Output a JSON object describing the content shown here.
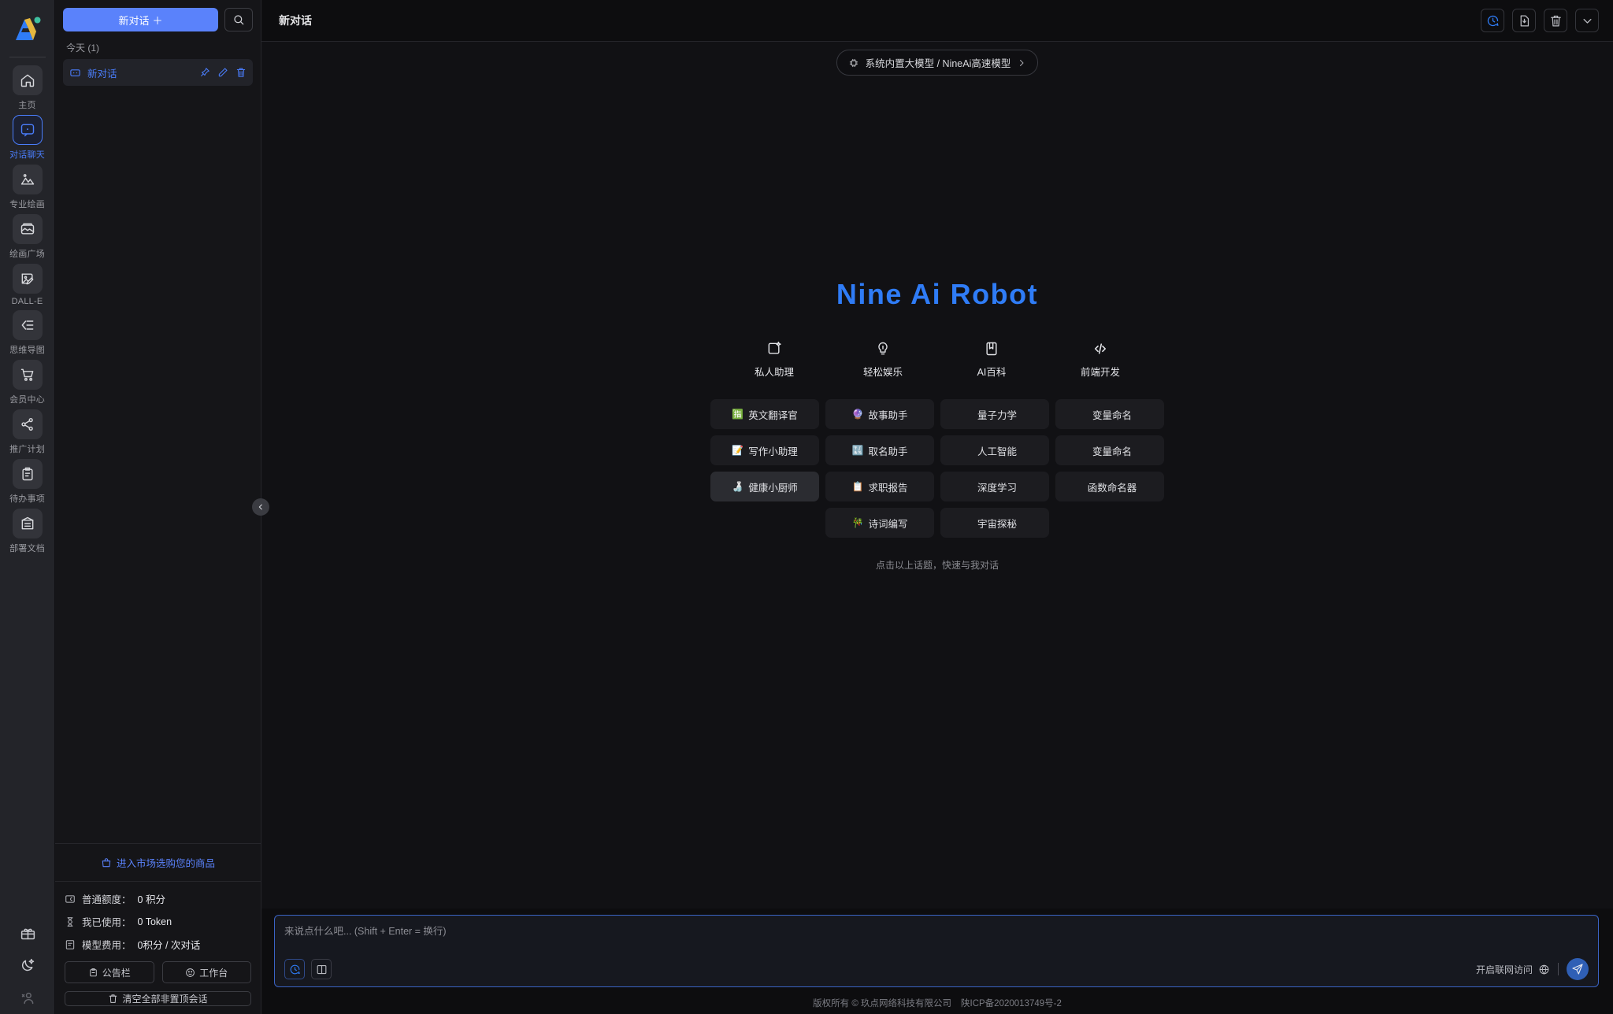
{
  "brand": {
    "logo_alt": "nine-ai-logo",
    "accent": "#4a7dfb",
    "title_color": "#2f7cf6"
  },
  "rail": {
    "items": [
      {
        "label": "主页",
        "icon": "home-icon",
        "active": false
      },
      {
        "label": "对话聊天",
        "icon": "chat-bubble-icon",
        "active": true
      },
      {
        "label": "专业绘画",
        "icon": "image-mountain-icon",
        "active": false
      },
      {
        "label": "绘画广场",
        "icon": "gallery-icon",
        "active": false
      },
      {
        "label": "DALL-E",
        "icon": "image-pen-icon",
        "active": false
      },
      {
        "label": "思维导图",
        "icon": "mindmap-icon",
        "active": false
      },
      {
        "label": "会员中心",
        "icon": "shopping-cart-icon",
        "active": false
      },
      {
        "label": "推广计划",
        "icon": "share-nodes-icon",
        "active": false
      },
      {
        "label": "待办事项",
        "icon": "clipboard-icon",
        "active": false
      },
      {
        "label": "部署文档",
        "icon": "document-archive-icon",
        "active": false
      }
    ],
    "bottom": [
      {
        "icon": "gift-icon",
        "name": "gift-button"
      },
      {
        "icon": "moon-star-icon",
        "name": "dark-mode-toggle"
      },
      {
        "icon": "add-user-icon",
        "name": "account-button"
      }
    ]
  },
  "conversations": {
    "new_chat_label": "新对话",
    "new_chat_plus": "＋",
    "search_icon": "search-icon",
    "group_title": "今天",
    "group_count": "(1)",
    "items": [
      {
        "name": "新对话",
        "icon": "chat-square-icon",
        "actions": [
          "pin-icon",
          "edit-icon",
          "delete-icon"
        ]
      }
    ],
    "market_link": "进入市场选购您的商品",
    "credits": [
      {
        "icon": "credit-card-icon",
        "label": "普通额度：",
        "value": "0 积分"
      },
      {
        "icon": "hourglass-icon",
        "label": "我已使用：",
        "value": "0 Token"
      },
      {
        "icon": "receipt-icon",
        "label": "模型费用：",
        "value": "0积分 / 次对话"
      }
    ],
    "buttons": [
      {
        "label": "公告栏",
        "icon": "megaphone-icon"
      },
      {
        "label": "工作台",
        "icon": "palette-icon"
      }
    ],
    "clear_button": {
      "label": "清空全部非置顶会话",
      "icon": "trash-icon"
    },
    "collapse_icon": "chevron-left-icon"
  },
  "topbar": {
    "title": "新对话",
    "actions": [
      {
        "name": "history-button",
        "icon": "clock-chat-icon",
        "accent": true
      },
      {
        "name": "save-file-button",
        "icon": "file-save-icon",
        "accent": false
      },
      {
        "name": "clear-button",
        "icon": "trash-icon",
        "accent": false
      },
      {
        "name": "more-button",
        "icon": "chevron-down-icon",
        "accent": false
      }
    ]
  },
  "model_selector": {
    "icon": "model-chip-icon",
    "label": "系统内置大模型 / NineAi高速模型",
    "chevron": "›"
  },
  "hero": {
    "title": "Nine Ai Robot",
    "categories": [
      {
        "label": "私人助理",
        "icon": "assistant-square-icon"
      },
      {
        "label": "轻松娱乐",
        "icon": "lightbulb-icon"
      },
      {
        "label": "AI百科",
        "icon": "book-icon"
      },
      {
        "label": "前端开发",
        "icon": "code-icon"
      }
    ],
    "cards": [
      {
        "emoji": "🈯",
        "label": "英文翻译官",
        "highlighted": false
      },
      {
        "emoji": "🔮",
        "label": "故事助手",
        "highlighted": false
      },
      {
        "emoji": "",
        "label": "量子力学",
        "highlighted": false
      },
      {
        "emoji": "",
        "label": "变量命名",
        "highlighted": false
      },
      {
        "emoji": "📝",
        "label": "写作小助理",
        "highlighted": false
      },
      {
        "emoji": "🔣",
        "label": "取名助手",
        "highlighted": false
      },
      {
        "emoji": "",
        "label": "人工智能",
        "highlighted": false
      },
      {
        "emoji": "",
        "label": "变量命名",
        "highlighted": false
      },
      {
        "emoji": "🍶",
        "label": "健康小厨师",
        "highlighted": true
      },
      {
        "emoji": "📋",
        "label": "求职报告",
        "highlighted": false
      },
      {
        "emoji": "",
        "label": "深度学习",
        "highlighted": false
      },
      {
        "emoji": "",
        "label": "函数命名器",
        "highlighted": false
      },
      {
        "emoji": "",
        "label": "",
        "highlighted": false,
        "empty": true
      },
      {
        "emoji": "🎋",
        "label": "诗词编写",
        "highlighted": false
      },
      {
        "emoji": "",
        "label": "宇宙探秘",
        "highlighted": false
      },
      {
        "emoji": "",
        "label": "",
        "highlighted": false,
        "empty": true
      }
    ],
    "hint": "点击以上话题，快速与我对话"
  },
  "input": {
    "placeholder": "来说点什么吧... (Shift + Enter = 换行)",
    "value": "",
    "tools": [
      {
        "name": "prompt-history-button",
        "icon": "clock-chat-icon",
        "accent": true
      },
      {
        "name": "prompt-library-button",
        "icon": "book-open-icon",
        "accent": false
      }
    ],
    "net_label": "开启联网访问",
    "net_icon": "globe-icon",
    "send_icon": "send-icon"
  },
  "footer": {
    "copyright": "版权所有 © 玖点网络科技有限公司",
    "icp": "陕ICP备2020013749号-2"
  }
}
